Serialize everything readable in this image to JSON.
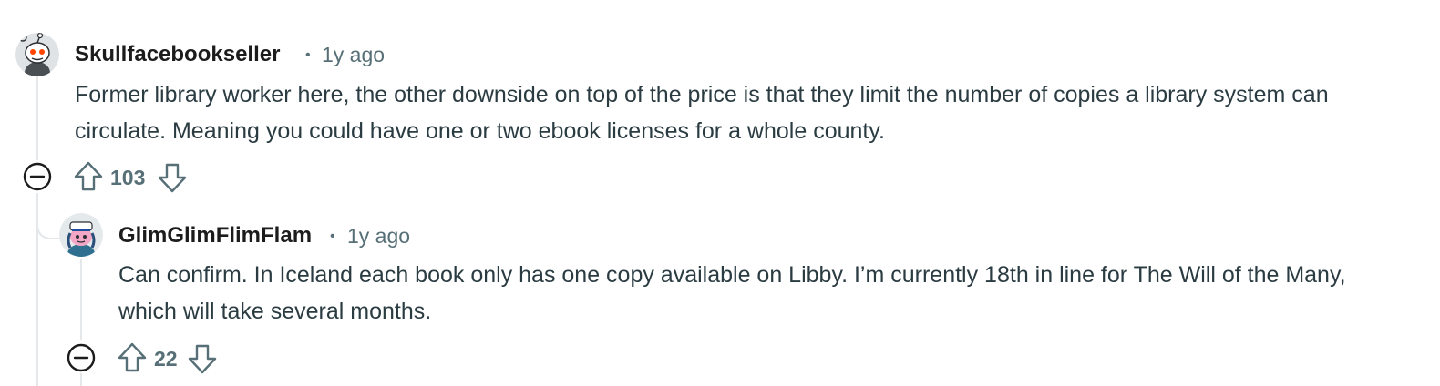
{
  "comments": [
    {
      "author": "Skullfacebookseller",
      "separator": "•",
      "age": "1y ago",
      "body": "Former library worker here, the other downside on top of the price is that they limit the number of copies a library system can circulate. Meaning you could have one or two ebook licenses for a whole county.",
      "score": "103",
      "avatar_icon": "snoo-skull-avatar-icon"
    },
    {
      "author": "GlimGlimFlimFlam",
      "separator": "•",
      "age": "1y ago",
      "body": "Can confirm. In Iceland each book only has one copy available on Libby. I’m currently 18th in line for The Will of the Many, which will take several months.",
      "score": "22",
      "avatar_icon": "snoo-sailor-avatar-icon"
    }
  ],
  "colors": {
    "text_primary": "#1c1c1c",
    "text_body": "#2a3c42",
    "text_meta": "#576f76",
    "thread_line": "#e5e8ea"
  },
  "icons": {
    "collapse": "collapse-minus-icon",
    "upvote": "upvote-arrow-icon",
    "downvote": "downvote-arrow-icon"
  }
}
